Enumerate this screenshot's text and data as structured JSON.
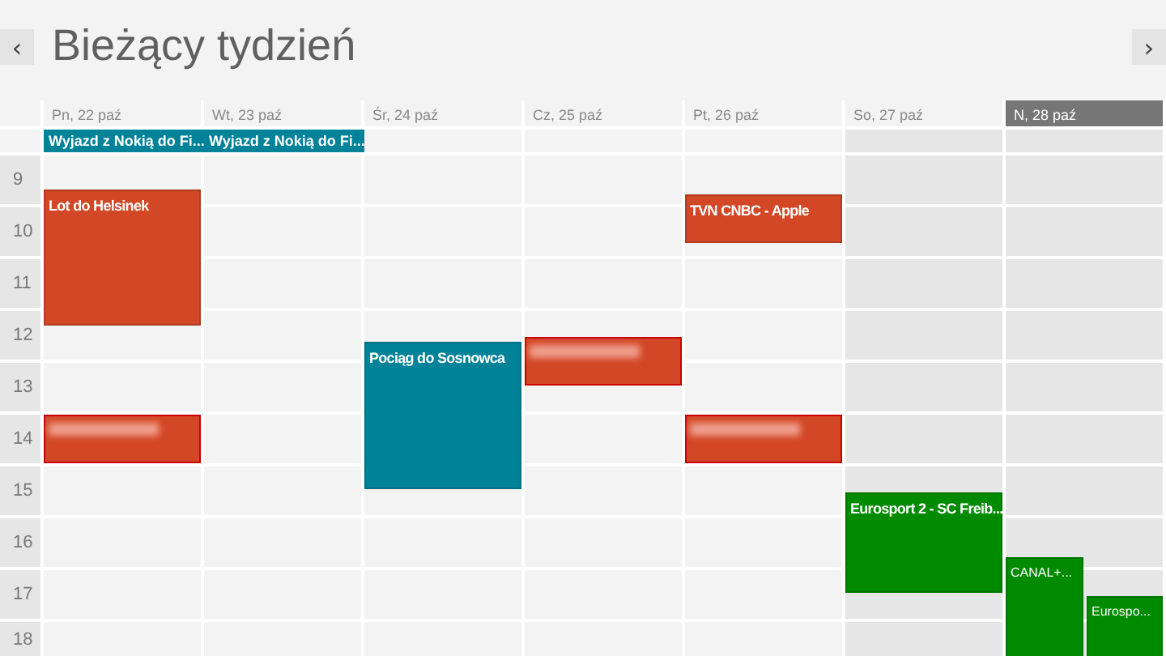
{
  "header": {
    "back_button": "‹",
    "title": "Bieżący tydzień",
    "forward_button": "›"
  },
  "hours": [
    "9",
    "10",
    "11",
    "12",
    "13",
    "14",
    "15",
    "16",
    "17",
    "18"
  ],
  "days": [
    {
      "label": "Pn, 22 paź",
      "weekend": false,
      "today": false,
      "all_day": [
        {
          "title": "Wyjazd z Nokią do Fi...",
          "color": "#008299"
        }
      ],
      "events": [
        {
          "title": "Lot do Helsinek",
          "blurred": false,
          "color": "#d24726"
        },
        {
          "blurred": true,
          "color": "#d24726"
        }
      ]
    },
    {
      "label": "Wt, 23 paź",
      "weekend": false,
      "today": false,
      "all_day": [
        {
          "title": "Wyjazd z Nokią do Fi...",
          "color": "#008299"
        }
      ]
    },
    {
      "label": "Śr, 24 paź",
      "weekend": false,
      "today": false,
      "events": [
        {
          "title": "Pociąg do Sosnowca",
          "blurred": false,
          "color": "#008299"
        }
      ]
    },
    {
      "label": "Cz, 25 paź",
      "weekend": false,
      "today": false,
      "events": [
        {
          "blurred": true,
          "color": "#d24726"
        }
      ]
    },
    {
      "label": "Pt, 26 paź",
      "weekend": false,
      "today": false,
      "events": [
        {
          "title": "TVN CNBC - Apple",
          "blurred": false,
          "color": "#d24726"
        },
        {
          "blurred": true,
          "color": "#d24726"
        }
      ]
    },
    {
      "label": "So, 27 paź",
      "weekend": true,
      "today": false,
      "events": [
        {
          "title": "Eurosport 2 - SC Freib...",
          "blurred": false,
          "color": "#008a00"
        }
      ]
    },
    {
      "label": "N, 28 paź",
      "weekend": true,
      "today": true,
      "events": [
        {
          "title": "CANAL+...",
          "blurred": false,
          "color": "#008a00"
        },
        {
          "title": "Eurospo...",
          "blurred": false,
          "color": "#008a00"
        }
      ]
    }
  ]
}
